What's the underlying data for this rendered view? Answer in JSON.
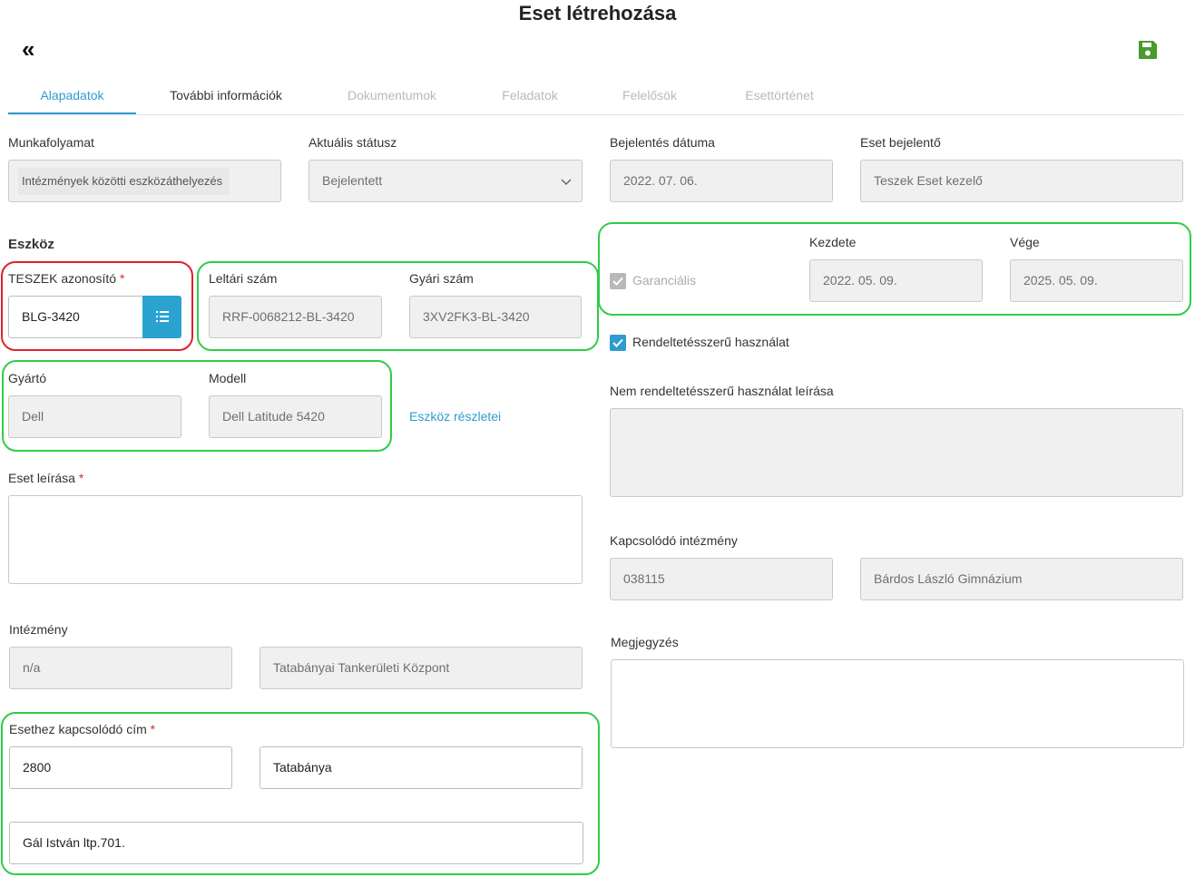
{
  "header": {
    "title": "Eset létrehozása"
  },
  "tabs": [
    {
      "label": "Alapadatok",
      "state": "active"
    },
    {
      "label": "További információk",
      "state": "normal"
    },
    {
      "label": "Dokumentumok",
      "state": "disabled"
    },
    {
      "label": "Feladatok",
      "state": "disabled"
    },
    {
      "label": "Felelősök",
      "state": "disabled"
    },
    {
      "label": "Esettörténet",
      "state": "disabled"
    }
  ],
  "form": {
    "workflow": {
      "label": "Munkafolyamat",
      "value": "Intézmények közötti eszközáthelyezés"
    },
    "status": {
      "label": "Aktuális státusz",
      "value": "Bejelentett"
    },
    "report_date": {
      "label": "Bejelentés dátuma",
      "value": "2022. 07. 06."
    },
    "reporter": {
      "label": "Eset bejelentő",
      "value": "Teszek Eset kezelő"
    },
    "device_section": "Eszköz",
    "teszek_id": {
      "label": "TESZEK azonosító",
      "required_mark": "*",
      "value": "BLG-3420"
    },
    "inventory_no": {
      "label": "Leltári szám",
      "value": "RRF-0068212-BL-3420"
    },
    "serial_no": {
      "label": "Gyári szám",
      "value": "3XV2FK3-BL-3420"
    },
    "warranty": {
      "label": "Garanciális",
      "checked": true,
      "disabled": true
    },
    "warranty_start": {
      "label": "Kezdete",
      "value": "2022. 05. 09."
    },
    "warranty_end": {
      "label": "Vége",
      "value": "2025. 05. 09."
    },
    "intended_use": {
      "label": "Rendeltetésszerű használat",
      "checked": true
    },
    "manufacturer": {
      "label": "Gyártó",
      "value": "Dell"
    },
    "model": {
      "label": "Modell",
      "value": "Dell Latitude 5420"
    },
    "device_details_link": "Eszköz részletei",
    "misuse_desc": {
      "label": "Nem rendeltetésszerű használat leírása",
      "value": ""
    },
    "case_desc": {
      "label": "Eset leírása",
      "required_mark": "*",
      "value": ""
    },
    "related_institution": {
      "label": "Kapcsolódó intézmény",
      "code": "038115",
      "name": "Bárdos László Gimnázium"
    },
    "institution": {
      "label": "Intézmény",
      "code": "n/a",
      "name": "Tatabányai Tankerületi Központ"
    },
    "note": {
      "label": "Megjegyzés",
      "value": ""
    },
    "address": {
      "label": "Esethez kapcsolódó cím",
      "required_mark": "*",
      "zip": "2800",
      "city": "Tatabánya",
      "street": "Gál István ltp.701."
    }
  },
  "colors": {
    "accent": "#2f9bd0",
    "save_icon": "#4a9a2c",
    "highlight_red": "#e0202a",
    "highlight_green": "#2fcd46",
    "required": "#d32f2f"
  },
  "icons": {
    "back": "double-chevron-left-icon",
    "save": "floppy-disk-icon",
    "list": "list-icon",
    "chevron": "chevron-down-icon",
    "check": "check-icon"
  }
}
